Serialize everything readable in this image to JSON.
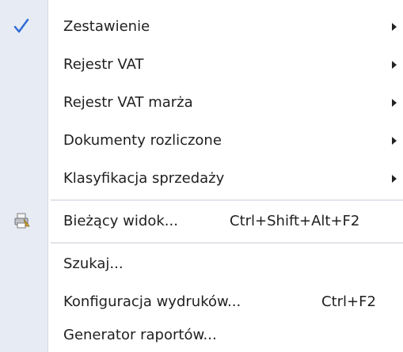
{
  "menu": {
    "items": [
      {
        "label": "Zestawienie",
        "checked": true,
        "submenu": true
      },
      {
        "label": "Rejestr VAT",
        "submenu": true
      },
      {
        "label": "Rejestr VAT marża",
        "submenu": true
      },
      {
        "label": "Dokumenty rozliczone",
        "submenu": true
      },
      {
        "label": "Klasyfikacja sprzedaży",
        "submenu": true
      },
      {
        "label": "Bieżący widok...",
        "shortcut": "Ctrl+Shift+Alt+F2",
        "icon": "printer-icon"
      },
      {
        "label": "Szukaj..."
      },
      {
        "label": "Konfiguracja wydruków...",
        "shortcut": "Ctrl+F2"
      },
      {
        "label": "Generator raportów..."
      }
    ]
  },
  "colors": {
    "gutter": "#e7ebf3",
    "check": "#2f6bd6",
    "text": "#1f1f1f"
  }
}
